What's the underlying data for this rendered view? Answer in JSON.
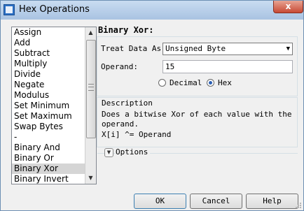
{
  "window": {
    "title": "Hex Operations",
    "close_label": "x"
  },
  "operations": {
    "items": [
      "Assign",
      "Add",
      "Subtract",
      "Multiply",
      "Divide",
      "Negate",
      "Modulus",
      "Set Minimum",
      "Set Maximum",
      "Swap Bytes",
      "-",
      "Binary And",
      "Binary Or",
      "Binary Xor",
      "Binary Invert"
    ],
    "selected_index": 13
  },
  "panel": {
    "title": "Binary Xor:",
    "treat_label": "Treat Data As:",
    "treat_value": "Unsigned Byte",
    "operand_label": "Operand:",
    "operand_value": "15",
    "radio_decimal": "Decimal",
    "radio_hex": "Hex",
    "radio_selected": "Hex"
  },
  "description": {
    "title": "Description",
    "text": "Does a bitwise Xor of each value with the operand.",
    "formula": "X[i] ^= Operand"
  },
  "options": {
    "label": "Options"
  },
  "buttons": {
    "ok": "OK",
    "cancel": "Cancel",
    "help": "Help"
  },
  "icons": {
    "app": "hex-operations-app-icon",
    "close": "close-icon",
    "dropdown": "chevron-down-icon",
    "scroll_up": "scroll-up-arrow-icon",
    "scroll_down": "scroll-down-arrow-icon",
    "options_expand": "expand-chevron-icon"
  }
}
